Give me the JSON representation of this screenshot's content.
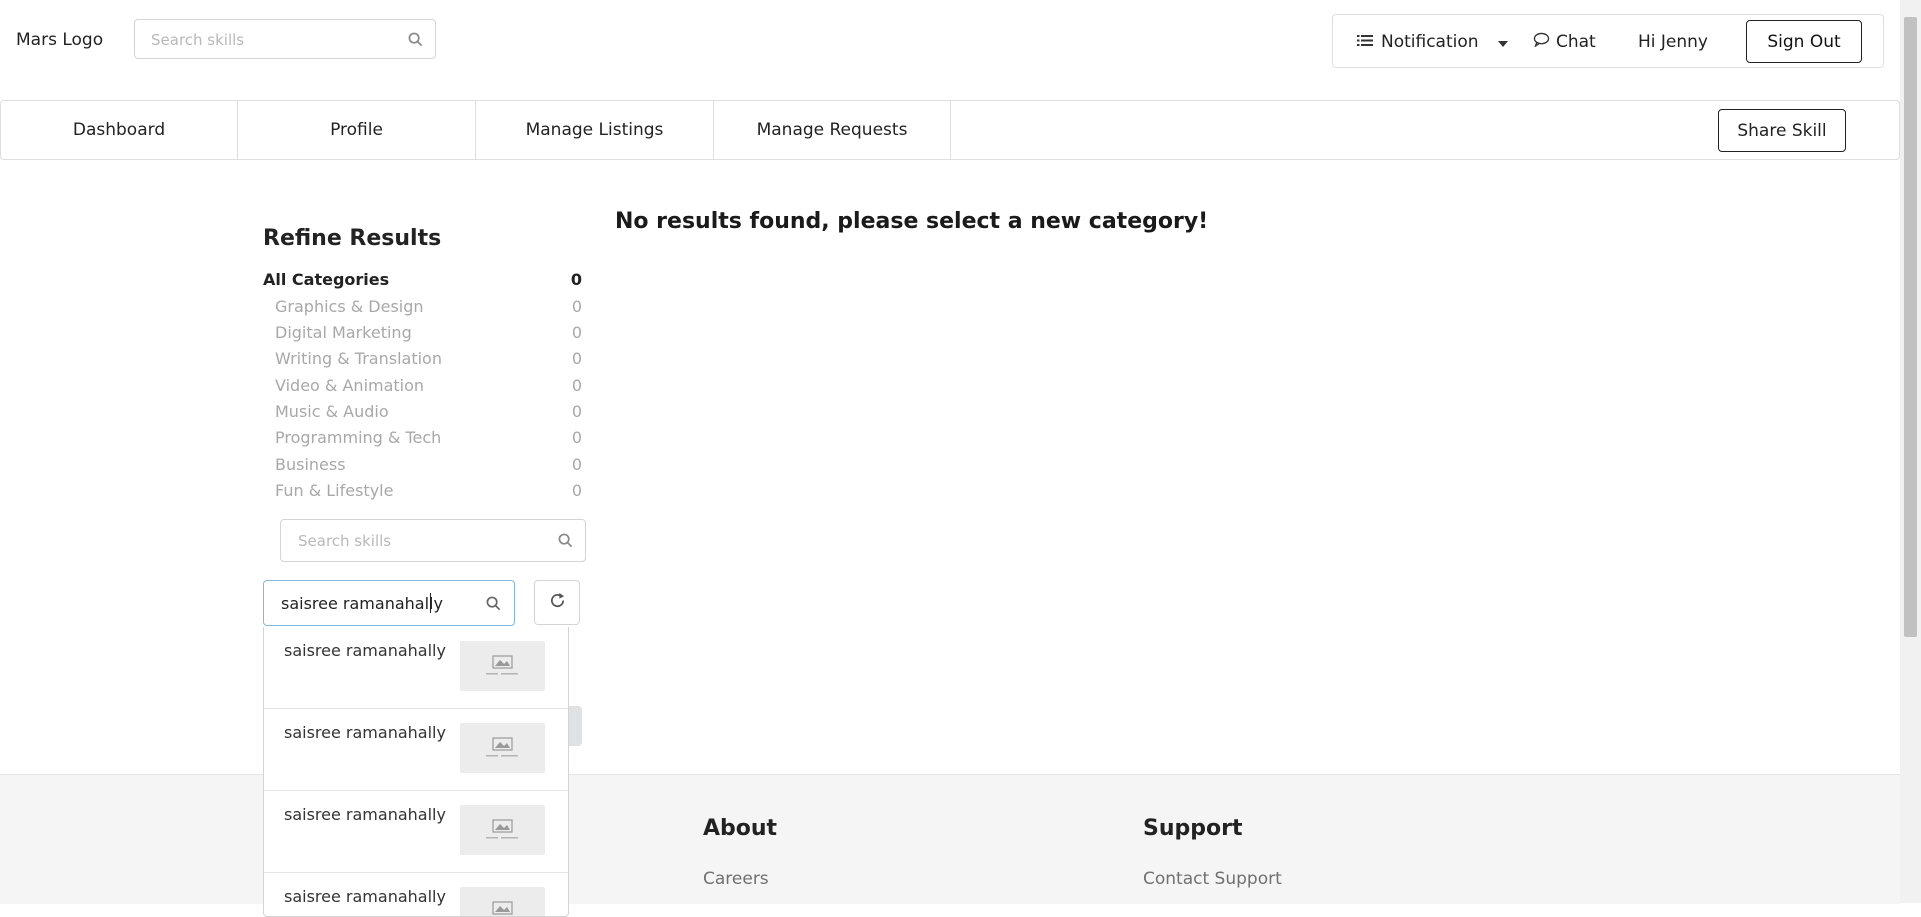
{
  "header": {
    "logo": "Mars Logo",
    "search_placeholder": "Search skills",
    "notification_label": "Notification",
    "chat_label": "Chat",
    "greeting": "Hi Jenny",
    "signout_label": "Sign Out"
  },
  "nav": {
    "tabs": [
      {
        "label": "Dashboard"
      },
      {
        "label": "Profile"
      },
      {
        "label": "Manage Listings"
      },
      {
        "label": "Manage Requests"
      }
    ],
    "share_label": "Share Skill"
  },
  "refine": {
    "title": "Refine Results",
    "all": {
      "label": "All Categories",
      "count": "0"
    },
    "categories": [
      {
        "label": "Graphics & Design",
        "count": "0"
      },
      {
        "label": "Digital Marketing",
        "count": "0"
      },
      {
        "label": "Writing & Translation",
        "count": "0"
      },
      {
        "label": "Video & Animation",
        "count": "0"
      },
      {
        "label": "Music & Audio",
        "count": "0"
      },
      {
        "label": "Programming & Tech",
        "count": "0"
      },
      {
        "label": "Business",
        "count": "0"
      },
      {
        "label": "Fun & Lifestyle",
        "count": "0"
      }
    ],
    "skill_search_placeholder": "Search skills",
    "user_search_value": "saisree ramanahally"
  },
  "main": {
    "no_results": "No results found, please select a new category!"
  },
  "dropdown": {
    "items": [
      {
        "name": "saisree ramanahally"
      },
      {
        "name": "saisree ramanahally"
      },
      {
        "name": "saisree ramanahally"
      },
      {
        "name": "saisree ramanahally"
      }
    ]
  },
  "footer": {
    "about_heading": "About",
    "about_link": "Careers",
    "support_heading": "Support",
    "support_link": "Contact Support"
  },
  "colors": {
    "focus_border": "#85b7d9",
    "footer_bg": "#f5f5f5",
    "muted_text": "#a8a8a8"
  },
  "icons": [
    "search-icon",
    "list-icon",
    "caret-down-icon",
    "chat-bubble-icon",
    "refresh-icon",
    "image-placeholder-icon"
  ]
}
